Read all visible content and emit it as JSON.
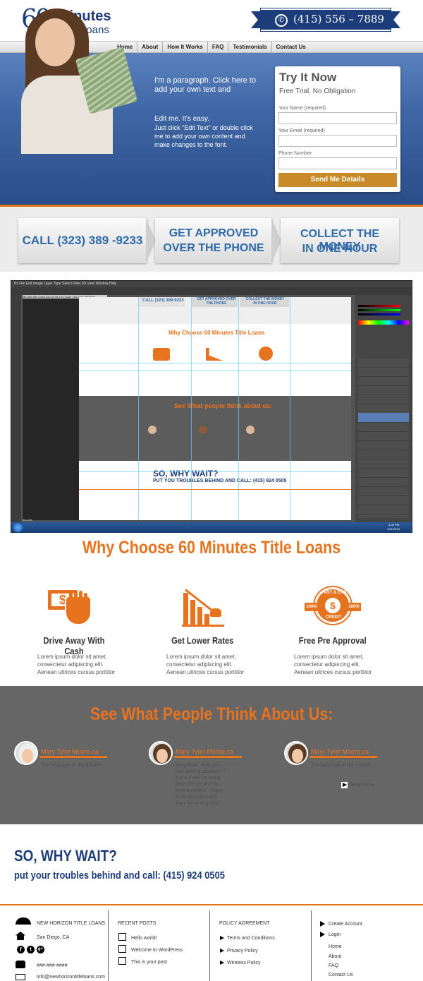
{
  "header": {
    "logo_number": "60",
    "logo_line1": "Minutes",
    "logo_line2": "Title Loans",
    "phone_icon": "phone-icon",
    "phone": "(415) 556 – 7889"
  },
  "nav": {
    "items": [
      "Home",
      "About",
      "How It Works",
      "FAQ",
      "Testimonials",
      "Contact Us"
    ],
    "active": "Home"
  },
  "hero": {
    "paragraph": "I'm a paragraph. Click here to add your own text and",
    "edit_line1": "Edit me. It's easy.",
    "edit_line2": "Just click \"Edit Text\" or double click me to add your own content and make changes to the font."
  },
  "form": {
    "title": "Try It Now",
    "subtitle": "Free Trial, No Obligation",
    "name_label": "Your Name (required)",
    "email_label": "Your Email (required)",
    "phone_label": "Phone Number",
    "button": "Send Me Details"
  },
  "steps": [
    {
      "line1": "CALL (323) 389 -9233",
      "line2": ""
    },
    {
      "line1": "GET APPROVED",
      "line2": "OVER THE PHONE"
    },
    {
      "line1": "COLLECT THE MONEY",
      "line2": "IN ONE HOUR"
    }
  ],
  "photoshop": {
    "menu": "Ps  File  Edit  Image  Layer  Type  Select  Filter  3D  View  Window  Help",
    "doc_tab": "Minutes title loans.psd @ 55.1% (Layer 181 copy, RGB/8)",
    "zoom": "55.12%",
    "clock_time": "3:05 PM",
    "clock_date": "12/1/2014",
    "mini_call": "CALL (323) 389-9233",
    "mini_approved": "GET APPROVED OVER THE PHONE",
    "mini_collect": "COLLECT THE MONEY IN ONE HOUR",
    "mini_why": "Why Choose 60 Minutes Title Loans",
    "mini_see": "See What people think about us:",
    "mini_wait": "SO, WHY WAIT?",
    "mini_call2": "PUT YOU TROUBLES BEHIND AND CALL: (415) 924 0505"
  },
  "why": {
    "title": "Why Choose 60 Minutes Title Loans",
    "features": [
      {
        "icon": "cash-hand-icon",
        "title": "Drive Away With Cash",
        "text": "Lorem ipsum dolor sit amet, consectetur adipiscing elit. Aenean ultrices cursus porttitor"
      },
      {
        "icon": "falling-chart-icon",
        "title": "Get Lower Rates",
        "text": "Lorem ipsum dolor sit amet, consectetur adipiscing elit. Aenean ultrices cursus porttitor"
      },
      {
        "icon": "fast-easy-credit-badge-icon",
        "title": "Free Pre Approval",
        "text": "Lorem ipsum dolor sit amet, consectetur adipiscing elit. Aenean ultrices cursus porttitor"
      }
    ],
    "badge_top": "FAST & EASY",
    "badge_left": "100%",
    "badge_right": "100%",
    "badge_bottom": "CREDIT"
  },
  "testimonials": {
    "title": "See What People Think About Us:",
    "items": [
      {
        "name": "Mary Tyler Moore.ca",
        "quote": "The best loan in the market"
      },
      {
        "name": "Mary Tyler Moore.ca",
        "quote": "Mary Poor, third loan had been a 'disaster'. I thank them for being there for me and for their business. I hope to do business with them for a long time"
      },
      {
        "name": "Mary Tyler Moore.ca",
        "quote": "The best loan in the market"
      }
    ],
    "read_more": "Read More"
  },
  "cta": {
    "line1": "SO, WHY WAIT?",
    "line2": "put your troubles behind and call: (415) 924 0505"
  },
  "footer": {
    "company": "NEW HORIZON TITLE LOANS",
    "location": "San Diego, CA",
    "phone": "###-###-####",
    "email": "info@newhorizontitleloans.com",
    "recent_posts_title": "RECENT POSTS",
    "recent_posts": [
      "Hello world!",
      "Welcome to WordPress",
      "This is your post"
    ],
    "policy_title": "POLICY AGREEMENT",
    "policy_links": [
      "Terms and Conditions",
      "Privacy Policy",
      "Wireless Policy"
    ],
    "account_links": [
      "Create Account",
      "Login"
    ],
    "site_links": [
      "Home",
      "About",
      "FAQ",
      "Contact Us"
    ]
  },
  "colors": {
    "brand_blue": "#1d3d7a",
    "accent_orange": "#e8731f",
    "button_gold": "#c98a2a",
    "testimonial_bg": "#666666"
  }
}
